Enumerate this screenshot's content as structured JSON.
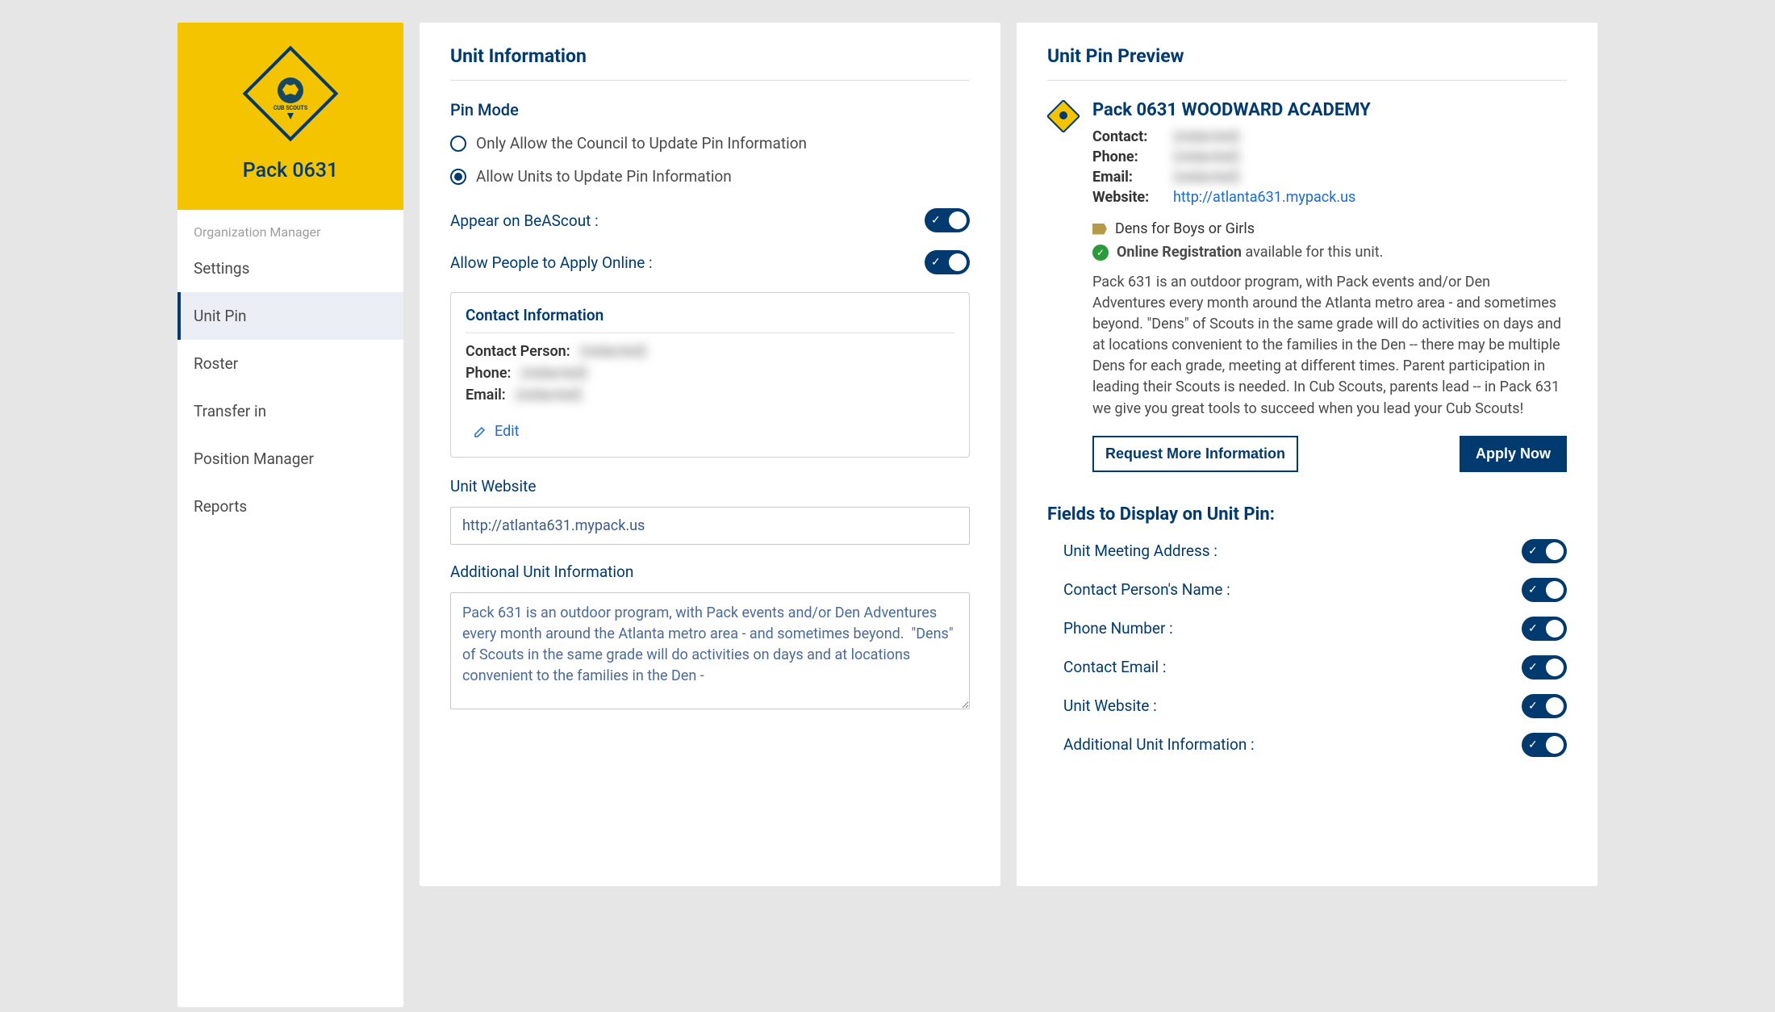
{
  "sidebar": {
    "pack": "Pack 0631",
    "section": "Organization Manager",
    "items": [
      "Settings",
      "Unit Pin",
      "Roster",
      "Transfer in",
      "Position Manager",
      "Reports"
    ],
    "active_index": 1
  },
  "unit_info": {
    "heading": "Unit Information",
    "pin_mode_label": "Pin Mode",
    "radio_council": "Only Allow the Council to Update Pin Information",
    "radio_units": "Allow Units to Update Pin Information",
    "appear_label": "Appear on BeAScout :",
    "allow_apply_label": "Allow People to Apply Online :",
    "contact_heading": "Contact Information",
    "contact_person_label": "Contact Person:",
    "contact_person_value": "(redacted)",
    "phone_label": "Phone:",
    "phone_value": "(redacted)",
    "email_label": "Email:",
    "email_value": "(redacted)",
    "edit_label": "Edit",
    "website_label": "Unit Website",
    "website_value": "http://atlanta631.mypack.us",
    "additional_label": "Additional Unit Information",
    "additional_value": "Pack 631 is an outdoor program, with Pack events and/or Den Adventures every month around the Atlanta metro area - and sometimes beyond.  \"Dens\" of Scouts in the same grade will do activities on days and at locations convenient to the families in the Den -"
  },
  "preview": {
    "heading": "Unit Pin Preview",
    "title": "Pack 0631 WOODWARD ACADEMY",
    "contact_label": "Contact:",
    "contact_value": "(redacted)",
    "phone_label": "Phone:",
    "phone_value": "(redacted)",
    "email_label": "Email:",
    "email_value": "(redacted)",
    "website_label": "Website:",
    "website_value": "http://atlanta631.mypack.us",
    "dens_text": "Dens for Boys or Girls",
    "online_reg_strong": "Online Registration",
    "online_reg_rest": " available for this unit.",
    "description": "Pack 631 is an outdoor program, with Pack events and/or Den Adventures every month around the Atlanta metro area - and sometimes beyond. \"Dens\" of Scouts in the same grade will do activities on days and at locations convenient to the families in the Den -- there may be multiple Dens for each grade, meeting at different times. Parent participation in leading their Scouts is needed. In Cub Scouts, parents lead -- in Pack 631 we give you great tools to succeed when you lead your Cub Scouts!",
    "request_btn": "Request More Information",
    "apply_btn": "Apply Now",
    "fields_heading": "Fields to Display on Unit Pin:",
    "fields": [
      "Unit Meeting Address :",
      "Contact Person's Name :",
      "Phone Number :",
      "Contact Email :",
      "Unit Website :",
      "Additional Unit Information :"
    ]
  }
}
